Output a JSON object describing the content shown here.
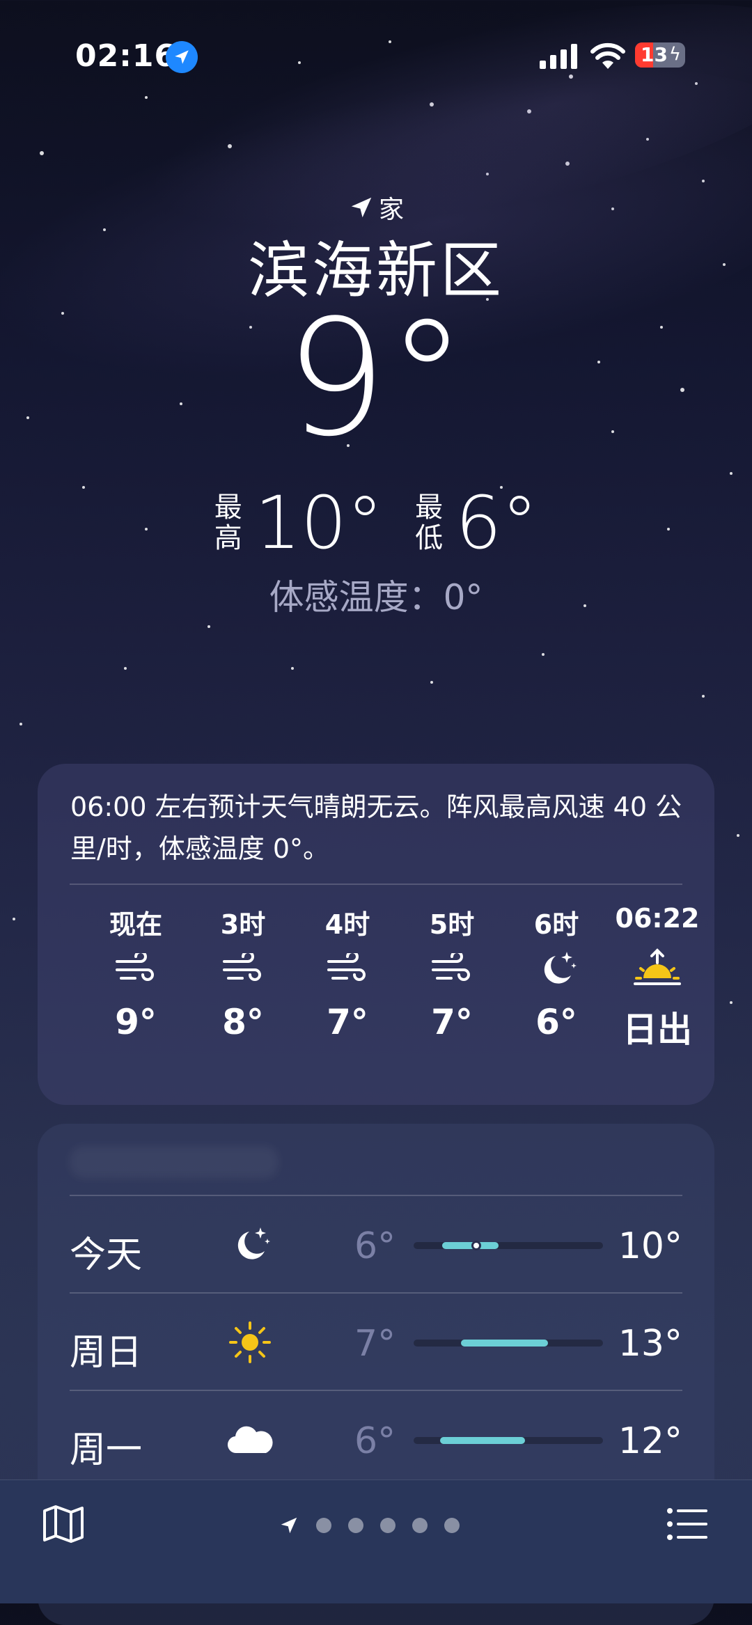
{
  "status_bar": {
    "time": "02:16",
    "battery": "13"
  },
  "location": {
    "tag": "家",
    "city": "滨海新区",
    "current_temp": "9°",
    "high_label": "最高",
    "high": "10°",
    "low_label": "最低",
    "low": "6°",
    "feels_like": "体感温度：0°"
  },
  "hourly_card": {
    "summary": "06:00 左右预计天气晴朗无云。阵风最高风速 40 公里/时，体感温度 0°。",
    "hours": [
      {
        "label": "现在",
        "icon": "wind-icon",
        "temp": "9°"
      },
      {
        "label": "3时",
        "icon": "wind-icon",
        "temp": "8°"
      },
      {
        "label": "4时",
        "icon": "wind-icon",
        "temp": "7°"
      },
      {
        "label": "5时",
        "icon": "wind-icon",
        "temp": "7°"
      },
      {
        "label": "6时",
        "icon": "moon-stars-icon",
        "temp": "6°"
      },
      {
        "label": "06:22",
        "icon": "sunrise-icon",
        "temp": "日出"
      }
    ]
  },
  "daily_card": {
    "days": [
      {
        "name": "今天",
        "icon": "moon-stars-icon",
        "low": "6°",
        "high": "10°",
        "range_start": 0.15,
        "range_end": 0.45,
        "current": 0.33
      },
      {
        "name": "周日",
        "icon": "sun-icon",
        "low": "7°",
        "high": "13°",
        "range_start": 0.25,
        "range_end": 0.71
      },
      {
        "name": "周一",
        "icon": "cloud-icon",
        "low": "6°",
        "high": "12°",
        "range_start": 0.14,
        "range_end": 0.59
      }
    ],
    "colors": {
      "range": "#6ccfd6"
    }
  },
  "bottom_bar": {
    "page_count": 5,
    "active_page": 0
  }
}
